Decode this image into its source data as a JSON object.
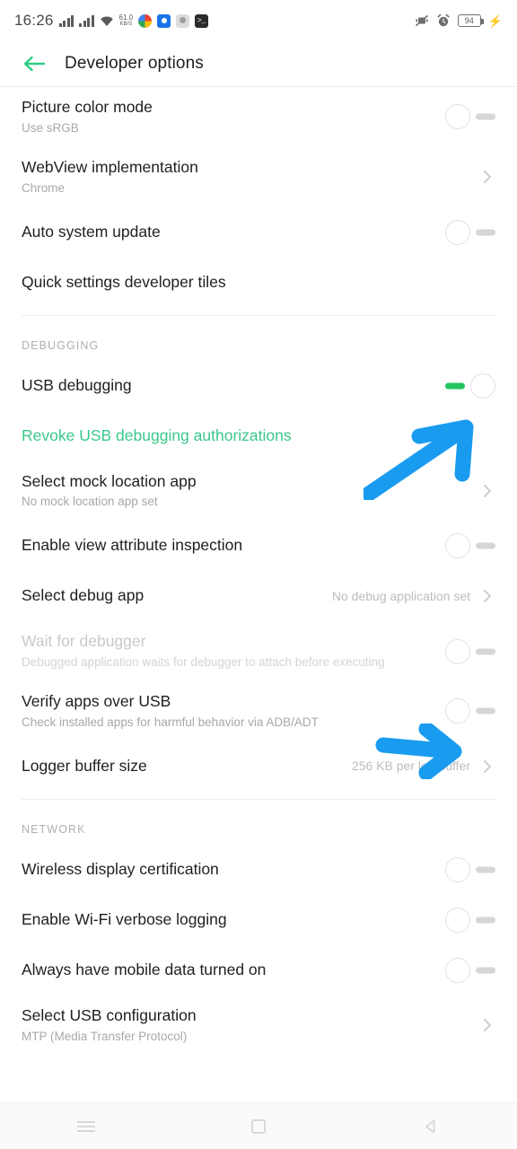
{
  "statusbar": {
    "time": "16:26",
    "network_speed_value": "61.0",
    "network_speed_unit": "KB/S",
    "battery_level": "94",
    "icons": {
      "signal_1": "signal-bars-icon",
      "signal_2": "signal-bars-icon",
      "wifi": "wifi-icon",
      "app_photos": "google-photos-icon",
      "app_blue": "blue-app-icon",
      "app_grey": "grey-app-icon",
      "app_terminal": "terminal-icon",
      "vibrate": "vibrate-mode-icon",
      "alarm": "alarm-clock-icon",
      "battery": "battery-icon",
      "charging": "charging-bolt-icon"
    }
  },
  "appbar": {
    "back_icon": "back-arrow-icon",
    "title": "Developer options",
    "accent_color": "#2fcb84"
  },
  "sections": [
    {
      "id": "top",
      "header": null,
      "rows": [
        {
          "title": "Picture color mode",
          "subtitle": "Use sRGB",
          "control": "switch",
          "state": "off"
        },
        {
          "title": "WebView implementation",
          "subtitle": "Chrome",
          "control": "chevron"
        },
        {
          "title": "Auto system update",
          "subtitle": null,
          "control": "switch",
          "state": "off"
        },
        {
          "title": "Quick settings developer tiles",
          "subtitle": null,
          "control": "none"
        }
      ]
    },
    {
      "id": "debugging",
      "header": "DEBUGGING",
      "rows": [
        {
          "title": "USB debugging",
          "subtitle": null,
          "control": "switch",
          "state": "on"
        },
        {
          "title": "Revoke USB debugging authorizations",
          "subtitle": null,
          "control": "none",
          "style": "link"
        },
        {
          "title": "Select mock location app",
          "subtitle": "No mock location app set",
          "control": "chevron"
        },
        {
          "title": "Enable view attribute inspection",
          "subtitle": null,
          "control": "switch",
          "state": "off"
        },
        {
          "title": "Select debug app",
          "subtitle": null,
          "value": "No debug application set",
          "control": "chevron"
        },
        {
          "title": "Wait for debugger",
          "subtitle": "Debugged application waits for debugger to attach before executing",
          "control": "switch",
          "state": "off",
          "style": "disabled"
        },
        {
          "title": "Verify apps over USB",
          "subtitle": "Check installed apps for harmful behavior via ADB/ADT",
          "control": "switch",
          "state": "off"
        },
        {
          "title": "Logger buffer size",
          "subtitle": null,
          "value": "256 KB per log buffer",
          "control": "chevron"
        }
      ]
    },
    {
      "id": "network",
      "header": "NETWORK",
      "rows": [
        {
          "title": "Wireless display certification",
          "subtitle": null,
          "control": "switch",
          "state": "off"
        },
        {
          "title": "Enable Wi-Fi verbose logging",
          "subtitle": null,
          "control": "switch",
          "state": "off"
        },
        {
          "title": "Always have mobile data turned on",
          "subtitle": null,
          "control": "switch",
          "state": "off"
        },
        {
          "title": "Select USB configuration",
          "subtitle": "MTP (Media Transfer Protocol)",
          "control": "chevron"
        }
      ]
    }
  ],
  "annotations": [
    {
      "id": "arrow-usb-debugging",
      "type": "arrow",
      "direction": "up-right",
      "color": "#199bf0",
      "points_to": "USB debugging toggle"
    },
    {
      "id": "arrow-verify-apps",
      "type": "arrow",
      "direction": "right",
      "color": "#199bf0",
      "points_to": "Verify apps over USB toggle"
    }
  ],
  "navbar": {
    "menu": "menu-icon",
    "home": "home-icon",
    "back": "back-triangle-icon"
  },
  "colors": {
    "accent_green": "#2fcb84",
    "link_green": "#3ac98a",
    "switch_on": "#22c55e",
    "annotation_blue": "#199bf0",
    "text_primary": "#1f1f1f",
    "text_secondary": "#a8a8a8"
  }
}
